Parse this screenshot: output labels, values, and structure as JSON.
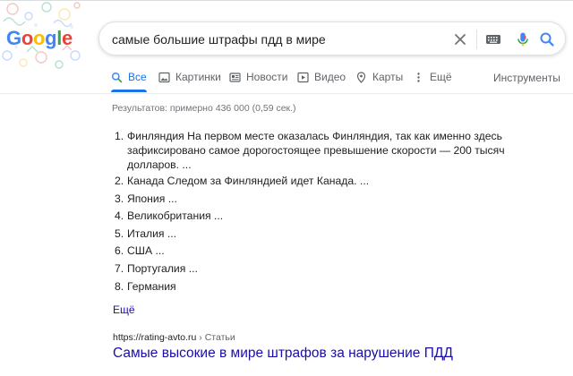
{
  "logo": {
    "letters": [
      "G",
      "o",
      "o",
      "g",
      "l",
      "e"
    ],
    "colors": [
      "#4285f4",
      "#ea4335",
      "#fbbc05",
      "#4285f4",
      "#34a853",
      "#ea4335"
    ]
  },
  "search": {
    "query": "самые большие штрафы пдд в мире"
  },
  "tabs": [
    {
      "label": "Все",
      "icon": "search-icon",
      "active": true
    },
    {
      "label": "Картинки",
      "icon": "image-icon"
    },
    {
      "label": "Новости",
      "icon": "news-icon"
    },
    {
      "label": "Видео",
      "icon": "video-icon"
    },
    {
      "label": "Карты",
      "icon": "map-pin-icon"
    },
    {
      "label": "Ещё",
      "icon": "more-vert-icon"
    }
  ],
  "tools_label": "Инструменты",
  "result_stats": "Результатов: примерно 436 000 (0,59 сек.)",
  "featured_list": {
    "items": [
      {
        "num": "1.",
        "lines": [
          "Финляндия На первом месте оказалась Финляндия, так как именно здесь",
          "зафиксировано самое дорогостоящее превышение скорости — 200 тысяч",
          "долларов. ..."
        ]
      },
      {
        "num": "2.",
        "text": "Канада Следом за Финляндией идет Канада. ..."
      },
      {
        "num": "3.",
        "text": "Япония ..."
      },
      {
        "num": "4.",
        "text": "Великобритания ..."
      },
      {
        "num": "5.",
        "text": "Италия ..."
      },
      {
        "num": "6.",
        "text": "США ..."
      },
      {
        "num": "7.",
        "text": "Португалия ..."
      },
      {
        "num": "8.",
        "text": "Германия"
      }
    ],
    "more_label": "Ещё"
  },
  "result": {
    "url": "https://rating-avto.ru",
    "breadcrumb": " › Статьи",
    "title": "Самые высокие в мире штрафов за нарушение ПДД"
  },
  "colors": {
    "link": "#1a0dab",
    "accent": "#1a73e8",
    "muted": "#5f6368"
  }
}
